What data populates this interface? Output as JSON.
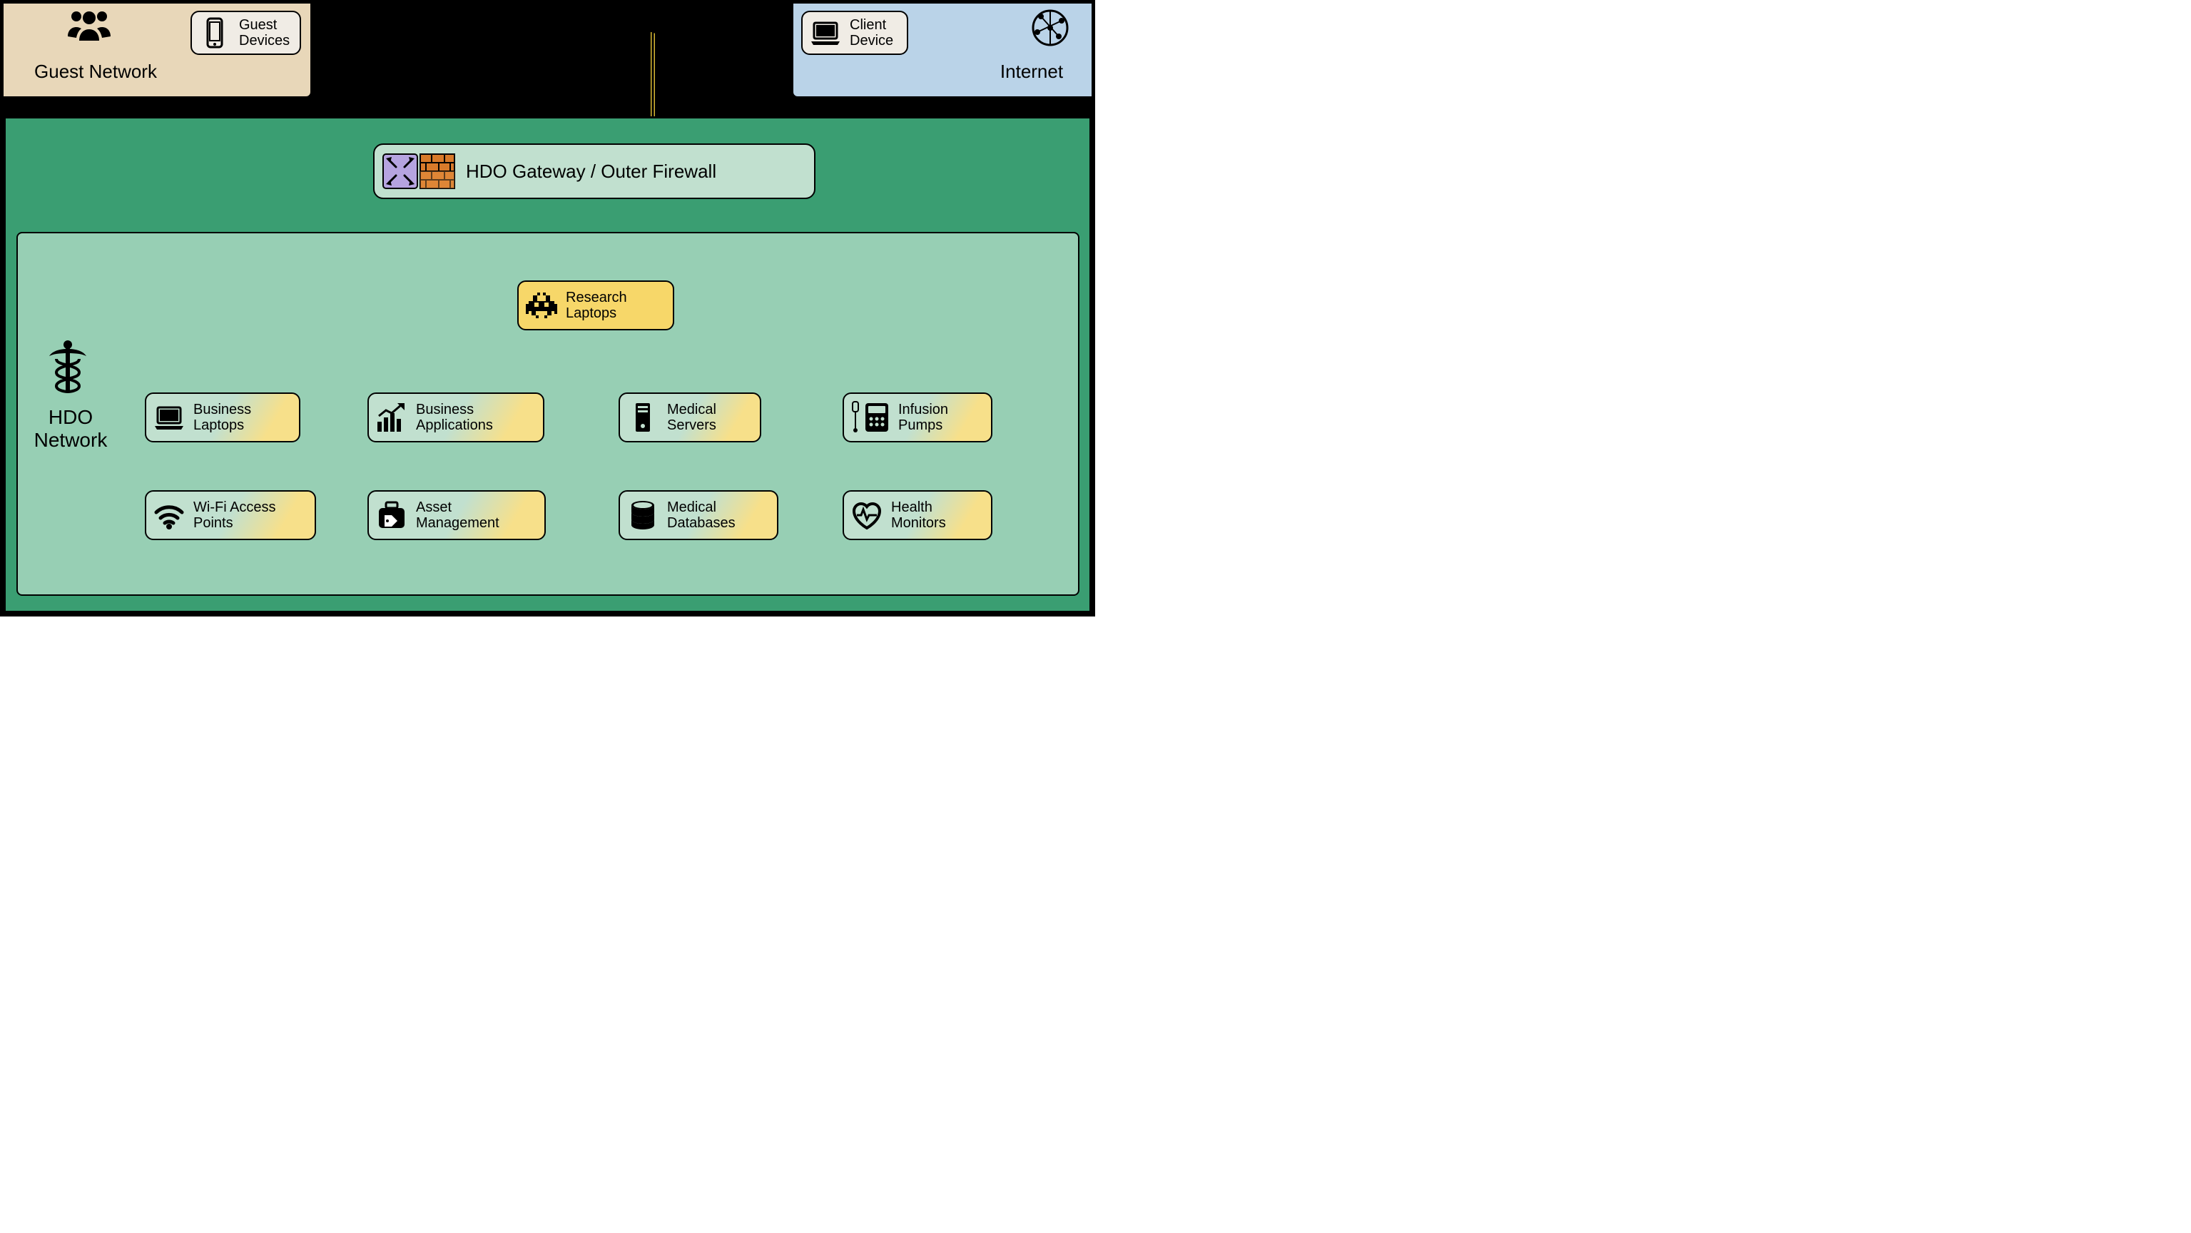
{
  "zones": {
    "guest": {
      "label": "Guest Network"
    },
    "internet": {
      "label": "Internet"
    },
    "hdo": {
      "label": "HDO Network"
    }
  },
  "gateway": {
    "label": "HDO Gateway / Outer Firewall"
  },
  "nodes": {
    "guest_devices": {
      "label": "Guest\nDevices"
    },
    "client_device": {
      "label": "Client\nDevice"
    },
    "research_laptops": {
      "label": "Research\nLaptops"
    },
    "business_laptops": {
      "label": "Business\nLaptops"
    },
    "business_apps": {
      "label": "Business\nApplications"
    },
    "medical_servers": {
      "label": "Medical\nServers"
    },
    "infusion_pumps": {
      "label": "Infusion\nPumps"
    },
    "wifi_aps": {
      "label": "Wi-Fi Access\nPoints"
    },
    "asset_mgmt": {
      "label": "Asset\nManagement"
    },
    "medical_dbs": {
      "label": "Medical\nDatabases"
    },
    "health_monitors": {
      "label": "Health\nMonitors"
    }
  },
  "colors": {
    "guest_zone": "#e8d7b9",
    "internet_zone": "#bad3e8",
    "hdo_zone_outer": "#3a9e72",
    "hdo_zone_inner": "#97cfb4",
    "node_default": "#c1e0cf",
    "node_light": "#f0ece5",
    "node_highlight": "#f7d769",
    "node_compromised_glow": "#f7e08a"
  },
  "icons": {
    "people": "people-group-icon",
    "smartphone": "smartphone-icon",
    "laptop": "laptop-icon",
    "globe": "globe-network-icon",
    "router": "router-switch-icon",
    "firewall": "firewall-brickwall-icon",
    "invader": "space-invader-icon",
    "chart": "chart-growth-icon",
    "server": "server-tower-icon",
    "infusion": "infusion-pump-icon",
    "wifi": "wifi-icon",
    "briefcase": "briefcase-tag-icon",
    "database": "database-stack-icon",
    "heart": "heart-monitor-icon",
    "caduceus": "caduceus-medical-icon"
  }
}
